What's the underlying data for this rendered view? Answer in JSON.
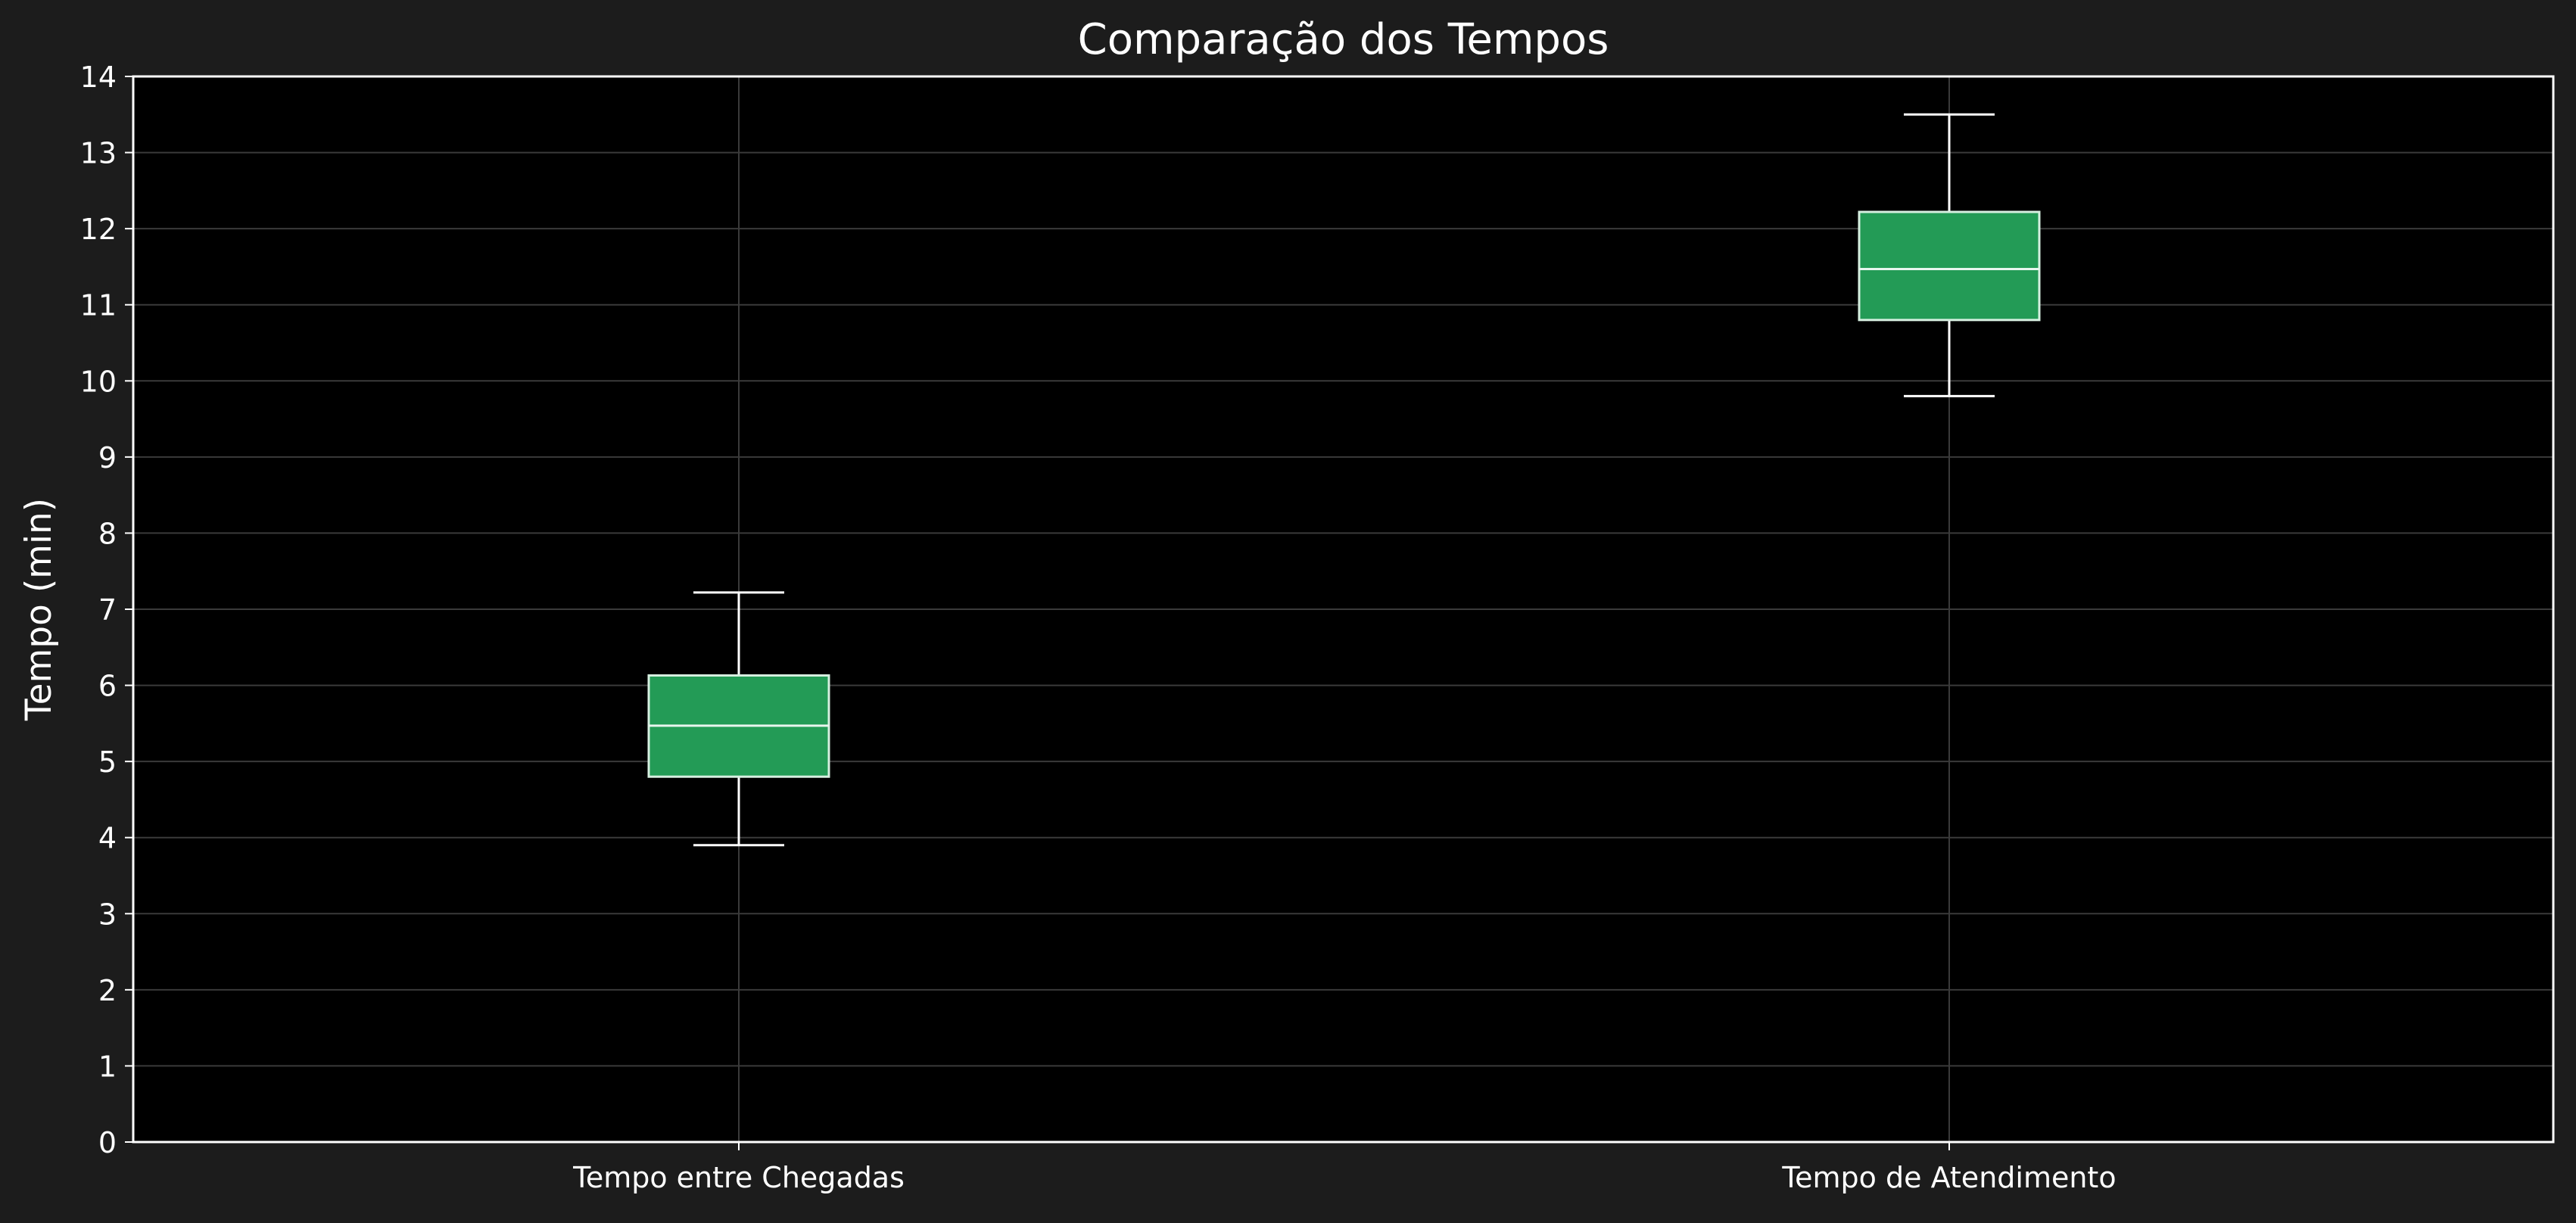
{
  "chart_data": {
    "type": "box",
    "title": "Comparação dos Tempos",
    "xlabel": "",
    "ylabel": "Tempo (min)",
    "ylim": [
      0,
      14
    ],
    "yticks": [
      0,
      1,
      2,
      3,
      4,
      5,
      6,
      7,
      8,
      9,
      10,
      11,
      12,
      13,
      14
    ],
    "grid": true,
    "categories": [
      "Tempo entre Chegadas",
      "Tempo de Atendimento"
    ],
    "boxes": [
      {
        "category": "Tempo entre Chegadas",
        "whisker_low": 3.9,
        "q1": 4.8,
        "median": 5.47,
        "q3": 6.13,
        "whisker_high": 7.22
      },
      {
        "category": "Tempo de Atendimento",
        "whisker_low": 9.8,
        "q1": 10.8,
        "median": 11.47,
        "q3": 12.22,
        "whisker_high": 13.5
      }
    ],
    "colors": {
      "page_background": "#1c1c1c",
      "plot_background": "#000000",
      "box_fill": "#239b56",
      "box_edge": "#d6efe0",
      "median": "#e8f5ee",
      "whisker": "#ffffff",
      "grid": "#3a3a3a",
      "axis": "#ffffff",
      "text": "#ffffff"
    }
  }
}
